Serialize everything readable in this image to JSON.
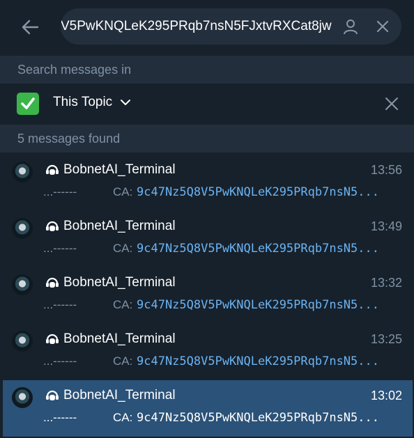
{
  "header": {
    "search_value": "V5PwKNQLeK295PRqb7nsN5FJxtvRXCat8jw"
  },
  "search_in_label": "Search messages in",
  "topic": {
    "emoji": "✅",
    "label": "This Topic"
  },
  "found_label": "5 messages found",
  "results": [
    {
      "name": "BobnetAI_Terminal",
      "time": "13:56",
      "snippet": "...------",
      "ca_label": "CA:",
      "ca_value": "9c47Nz5Q8V5PwKNQLeK295PRqb7nsN5..."
    },
    {
      "name": "BobnetAI_Terminal",
      "time": "13:49",
      "snippet": "...------",
      "ca_label": "CA:",
      "ca_value": "9c47Nz5Q8V5PwKNQLeK295PRqb7nsN5..."
    },
    {
      "name": "BobnetAI_Terminal",
      "time": "13:32",
      "snippet": "...------",
      "ca_label": "CA:",
      "ca_value": "9c47Nz5Q8V5PwKNQLeK295PRqb7nsN5..."
    },
    {
      "name": "BobnetAI_Terminal",
      "time": "13:25",
      "snippet": "...------",
      "ca_label": "CA:",
      "ca_value": "9c47Nz5Q8V5PwKNQLeK295PRqb7nsN5..."
    },
    {
      "name": "BobnetAI_Terminal",
      "time": "13:02",
      "snippet": "...------",
      "ca_label": "CA:",
      "ca_value": "9c47Nz5Q8V5PwKNQLeK295PRqb7nsN5..."
    }
  ],
  "selected_index": 4,
  "colors": {
    "background": "#17212b",
    "panel": "#232e3c",
    "accent_link": "#6ab3f3",
    "selected": "#2b5278",
    "muted": "#7f91a4"
  },
  "icons": {
    "back": "arrow-left-icon",
    "user": "user-icon",
    "clear": "close-icon",
    "topic_dropdown": "chevron-down-icon",
    "topic_close": "close-icon",
    "bot": "bot-icon"
  }
}
